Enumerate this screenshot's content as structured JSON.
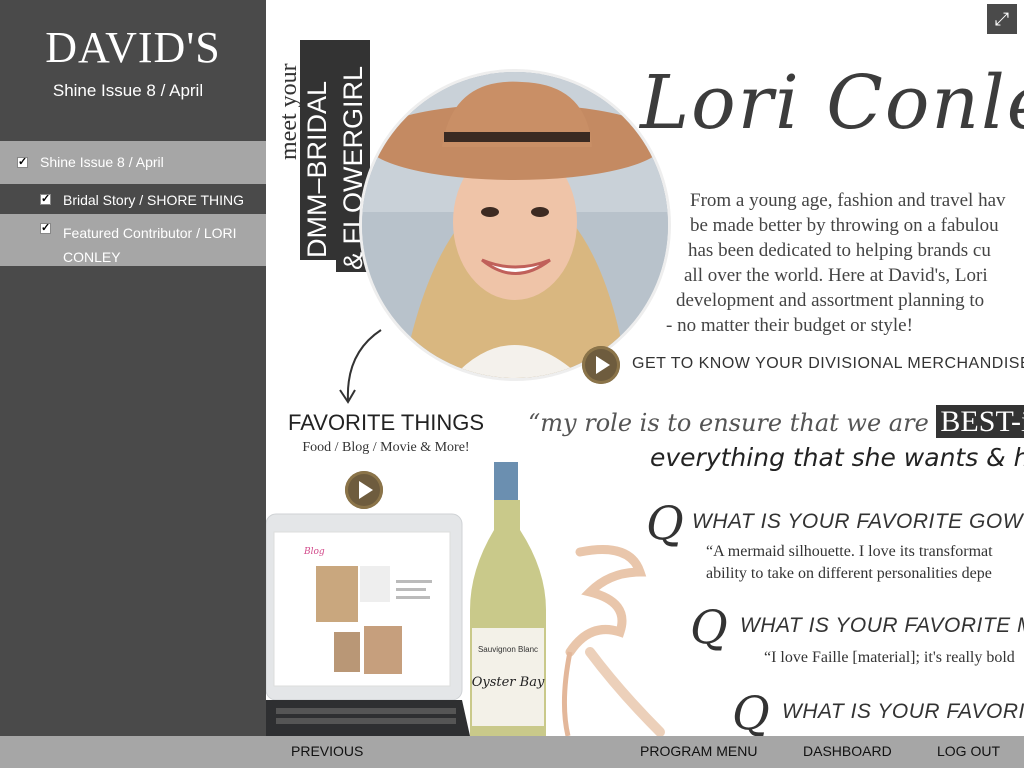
{
  "sidebar": {
    "logo": "DAVID'S",
    "issue_heading": "Shine Issue 8 / April",
    "nav": [
      {
        "label": "Shine Issue 8 / April",
        "checked": true
      },
      {
        "label": "Bridal Story / SHORE THING",
        "checked": true
      },
      {
        "label": "Featured Contributor / LORI CONLEY",
        "checked": true
      }
    ]
  },
  "article": {
    "meet_your": "meet your",
    "role_line1": "DMM–BRIDAL",
    "role_line2": "& FLOWERGIRL",
    "name": "Lori Conley",
    "bio_lines": [
      "From a young age, fashion and travel hav",
      "be made better by throwing on a fabulou",
      "has been dedicated to helping brands cu",
      "all over the world. Here at David's, Lori",
      "development and assortment planning to",
      "- no matter their budget or style!"
    ],
    "get_to_know": "GET TO KNOW YOUR DIVISIONAL MERCHANDISE MA",
    "favorites_title": "FAVORITE THINGS",
    "favorites_sub": "Food / Blog / Movie & More!",
    "quote_prefix": "“my role is to ensure that we are",
    "quote_highlight": "BEST-in-C",
    "quote_line2": "everything that she wants & h",
    "q_mark": "Q",
    "questions": [
      {
        "question": "WHAT IS YOUR FAVORITE GOW",
        "answer_lines": [
          "“A mermaid silhouette. I love its transformat",
          "ability to take on different personalities depe"
        ]
      },
      {
        "question": "WHAT IS YOUR FAVORITE M",
        "answer_lines": [
          "“I love Faille [material]; it's really bold"
        ]
      },
      {
        "question": "WHAT IS YOUR FAVORIT",
        "answer_lines": []
      }
    ],
    "wine_label": "Sauvignon Blanc",
    "wine_brand": "Oyster Bay"
  },
  "footer": {
    "previous": "PREVIOUS",
    "program_menu": "PROGRAM MENU",
    "dashboard": "DASHBOARD",
    "logout": "LOG OUT"
  }
}
